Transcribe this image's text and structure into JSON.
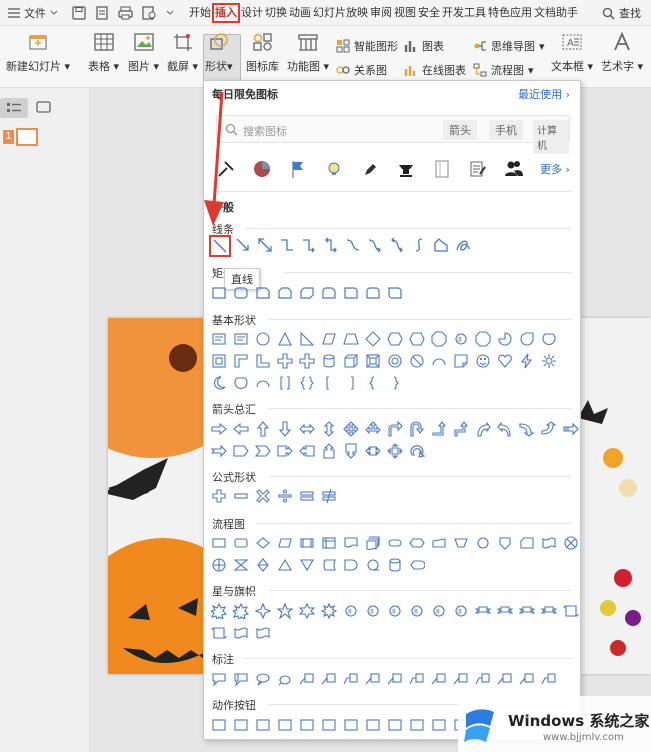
{
  "menubar": {
    "file_label": "文件",
    "tabs": [
      "开始",
      "插入",
      "设计",
      "切换",
      "动画",
      "幻灯片放映",
      "审阅",
      "视图",
      "安全",
      "开发工具",
      "特色应用",
      "文档助手"
    ],
    "active_tab": "插入",
    "search_label": "查找"
  },
  "ribbon": {
    "new_slide": "新建幻灯片",
    "table": "表格",
    "picture": "图片",
    "screenshot": "截屏",
    "shape": "形状",
    "icon_library": "图标库",
    "function_chart": "功能图",
    "smart_shape": "智能图形",
    "chart": "图表",
    "mind_map": "思维导图",
    "relation": "关系图",
    "online_chart": "在线图表",
    "flowchart": "流程图",
    "textbox": "文本框",
    "art_text": "艺术字"
  },
  "dropdown": {
    "title": "每日限免图标",
    "recent_link": "最近使用",
    "search_placeholder": "搜索图标",
    "search_tags": [
      "箭头",
      "手机",
      "计算机"
    ],
    "more_label": "更多",
    "section_general": "一般",
    "tooltip": "直线",
    "categories": {
      "lines": "线条",
      "rect": "矩形",
      "basic": "基本形状",
      "arrows": "箭头总汇",
      "formula": "公式形状",
      "flow": "流程图",
      "stars": "星与旗帜",
      "callout": "标注",
      "action": "动作按钮"
    }
  },
  "sidebar": {
    "slide_number": "1"
  },
  "watermark": {
    "brand": "Windows 系统之家",
    "url": "www.bjjmlv.com"
  },
  "colors": {
    "accent": "#e03a2f",
    "shape_stroke": "#4a79c4",
    "link": "#2f6ec7"
  }
}
